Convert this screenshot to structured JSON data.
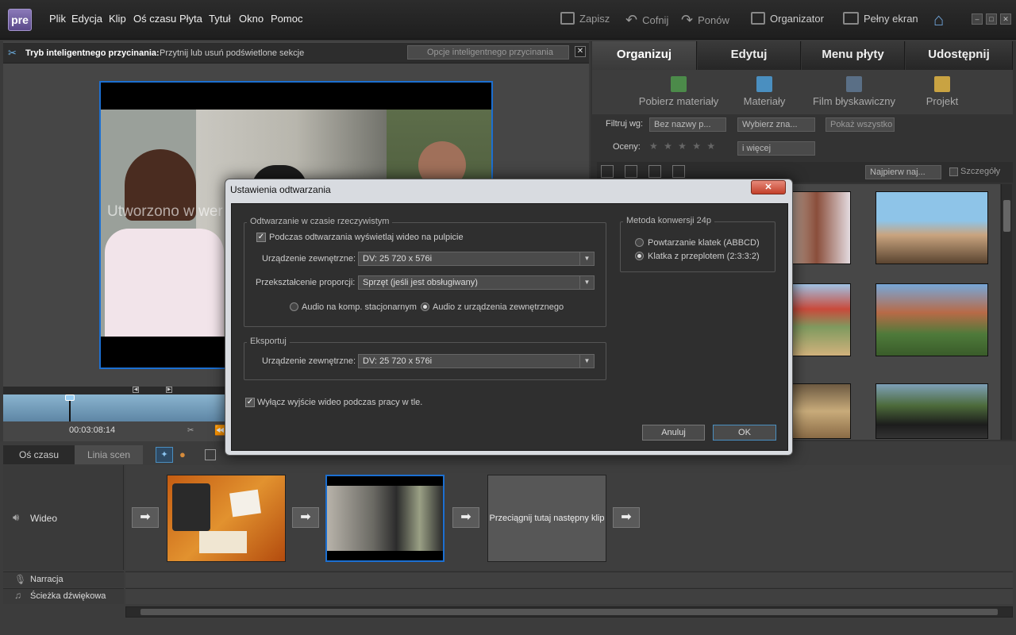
{
  "app": {
    "logo": "pre"
  },
  "menu": [
    "Plik",
    "Edycja",
    "Klip",
    "Oś czasu",
    "Płyta",
    "Tytuł",
    "Okno",
    "Pomoc"
  ],
  "toolbar": {
    "save": "Zapisz",
    "undo": "Cofnij",
    "redo": "Ponów",
    "organizer": "Organizator",
    "fullscreen": "Pełny ekran"
  },
  "smarttrim": {
    "title": "Tryb inteligentnego przycinania:",
    "desc": "Przytnij lub usuń podświetlone sekcje",
    "options": "Opcje inteligentnego przycinania"
  },
  "monitor": {
    "watermark": "Utworzono w wer",
    "timecode": "00:03:08:14"
  },
  "right": {
    "tabs": [
      "Organizuj",
      "Edytuj",
      "Menu płyty",
      "Udostępnij"
    ],
    "actions": [
      "Pobierz materiały",
      "Materiały",
      "Film błyskawiczny",
      "Projekt"
    ],
    "filter_label": "Filtruj wg:",
    "filter_value": "Bez nazwy p...",
    "choose": "Wybierz zna...",
    "show_all": "Pokaż wszystko",
    "ratings_label": "Oceny:",
    "stars": "★ ★ ★ ★ ★",
    "and_more": "i więcej",
    "sort": "Najpierw naj...",
    "details": "Szczegóły"
  },
  "timeline": {
    "tabs": [
      "Oś czasu",
      "Linia scen"
    ],
    "video_label": "Wideo",
    "narration_label": "Narracja",
    "soundtrack_label": "Ścieżka dźwiękowa",
    "drop_text": "Przeciągnij tutaj następny klip"
  },
  "dialog": {
    "title": "Ustawienia odtwarzania",
    "close": "✕",
    "realtime_group": "Odtwarzanie w czasie rzeczywistym",
    "show_on_desktop": "Podczas odtwarzania wyświetlaj wideo na pulpicie",
    "external_device_label": "Urządzenie zewnętrzne:",
    "external_device_value": "DV:  25 720 x 576i",
    "aspect_label": "Przekształcenie proporcji:",
    "aspect_value": "Sprzęt (jeśli jest obsługiwany)",
    "audio_desktop": "Audio na komp. stacjonarnym",
    "audio_external": "Audio z urządzenia zewnętrznego",
    "export_group": "Eksportuj",
    "export_device_label": "Urządzenie zewnętrzne:",
    "export_device_value": "DV:  25 720 x 576i",
    "disable_bg": "Wyłącz wyjście wideo podczas pracy w tle.",
    "conv_group": "Metoda konwersji 24p",
    "conv_repeat": "Powtarzanie klatek (ABBCD)",
    "conv_interlace": "Klatka z przeplotem (2:3:3:2)",
    "cancel": "Anuluj",
    "ok": "OK"
  }
}
